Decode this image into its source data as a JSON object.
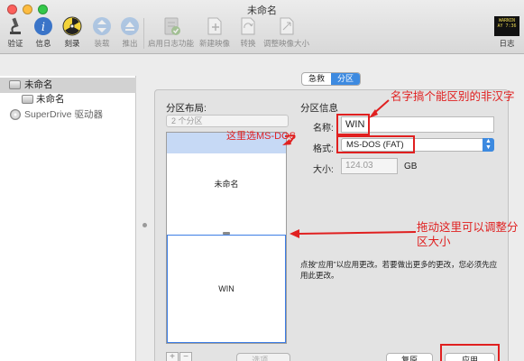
{
  "window": {
    "title": "未命名"
  },
  "toolbar": {
    "items": [
      {
        "label": "验证",
        "icon": "microscope-icon",
        "enabled": true
      },
      {
        "label": "信息",
        "icon": "info-icon",
        "enabled": true
      },
      {
        "label": "刻录",
        "icon": "burn-icon",
        "enabled": true
      },
      {
        "label": "装载",
        "icon": "mount-icon",
        "enabled": false
      },
      {
        "label": "推出",
        "icon": "eject-icon",
        "enabled": false
      },
      {
        "label": "启用日志功能",
        "icon": "enable-journaling-icon",
        "enabled": false
      },
      {
        "label": "新建映像",
        "icon": "new-image-icon",
        "enabled": false
      },
      {
        "label": "转换",
        "icon": "convert-icon",
        "enabled": false
      },
      {
        "label": "调整映像大小",
        "icon": "resize-image-icon",
        "enabled": false
      },
      {
        "label": "日志",
        "icon": "log-icon",
        "enabled": true
      }
    ],
    "log_icon_text": [
      "WARNIN",
      "AY 7:36"
    ]
  },
  "sidebar": {
    "items": [
      {
        "label": "未命名",
        "level": 0,
        "icon": "disk-icon",
        "selected": true
      },
      {
        "label": "未命名",
        "level": 1,
        "icon": "volume-icon",
        "selected": false
      },
      {
        "label": "SuperDrive 驱动器",
        "level": 0,
        "icon": "optical-drive-icon",
        "selected": false
      }
    ]
  },
  "tabs": [
    {
      "label": "急救",
      "active": false
    },
    {
      "label": "分区",
      "active": true
    }
  ],
  "partition_layout": {
    "heading": "分区布局:",
    "scheme_value": "2 个分区",
    "partitions": [
      {
        "name": "未命名"
      },
      {
        "name": "WIN"
      }
    ],
    "add_label": "+",
    "remove_label": "−",
    "options_label": "选项..."
  },
  "partition_info": {
    "heading": "分区信息",
    "name_label": "名称:",
    "name_value": "WIN",
    "format_label": "格式:",
    "format_value": "MS-DOS (FAT)",
    "size_label": "大小:",
    "size_value": "124.03",
    "size_unit": "GB",
    "description": "点按“应用”以应用更改。若要做出更多的更改，您必须先应用此更改。"
  },
  "buttons": {
    "revert": "复原",
    "apply": "应用"
  },
  "annotations": {
    "name_note": "名字搞个能区别的非汉字",
    "format_note": "这里选MS-DOS",
    "resize_note": "拖动这里可以调整分区大小",
    "color": "#e02020"
  }
}
